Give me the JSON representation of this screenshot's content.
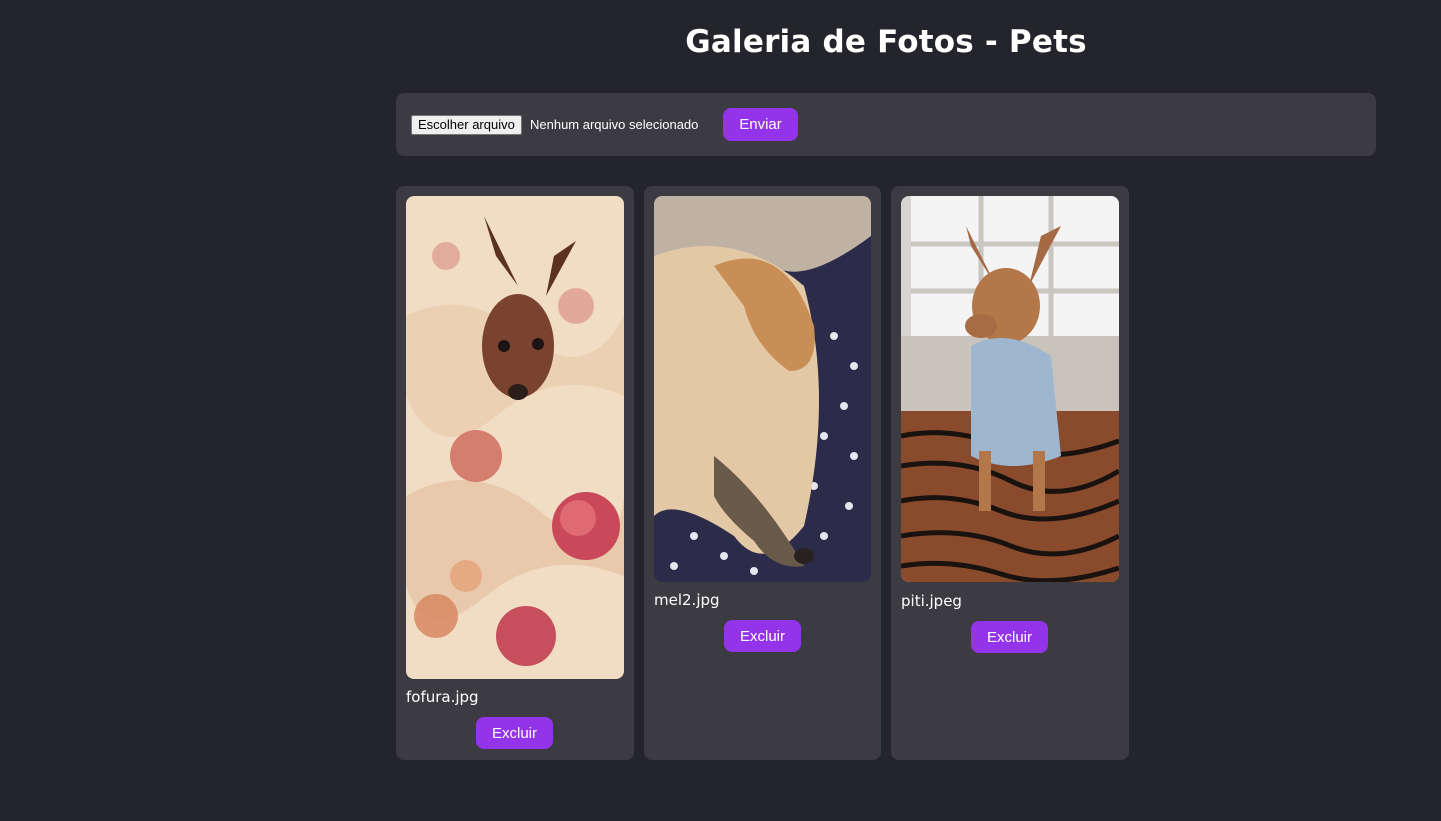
{
  "header": {
    "title": "Galeria de Fotos - Pets"
  },
  "upload": {
    "choose_label": "Escolher arquivo",
    "status_text": "Nenhum arquivo selecionado",
    "submit_label": "Enviar"
  },
  "gallery": {
    "items": [
      {
        "filename": "fofura.jpg",
        "delete_label": "Excluir"
      },
      {
        "filename": "mel2.jpg",
        "delete_label": "Excluir"
      },
      {
        "filename": "piti.jpeg",
        "delete_label": "Excluir"
      }
    ]
  },
  "colors": {
    "background": "#24242d",
    "panel": "#3b3b41",
    "accent": "#9334ea"
  }
}
